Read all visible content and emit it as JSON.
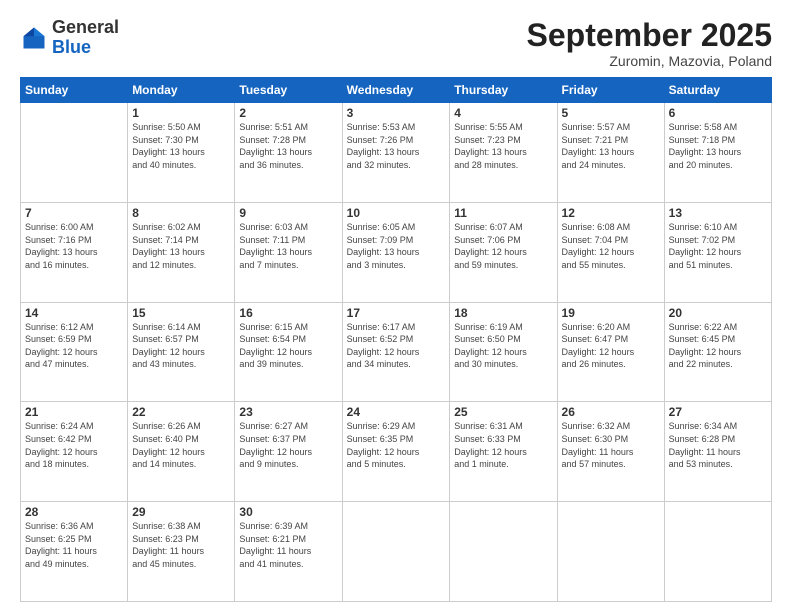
{
  "header": {
    "logo_general": "General",
    "logo_blue": "Blue",
    "month_title": "September 2025",
    "subtitle": "Zuromin, Mazovia, Poland"
  },
  "columns": [
    "Sunday",
    "Monday",
    "Tuesday",
    "Wednesday",
    "Thursday",
    "Friday",
    "Saturday"
  ],
  "weeks": [
    [
      {
        "num": "",
        "info": ""
      },
      {
        "num": "1",
        "info": "Sunrise: 5:50 AM\nSunset: 7:30 PM\nDaylight: 13 hours\nand 40 minutes."
      },
      {
        "num": "2",
        "info": "Sunrise: 5:51 AM\nSunset: 7:28 PM\nDaylight: 13 hours\nand 36 minutes."
      },
      {
        "num": "3",
        "info": "Sunrise: 5:53 AM\nSunset: 7:26 PM\nDaylight: 13 hours\nand 32 minutes."
      },
      {
        "num": "4",
        "info": "Sunrise: 5:55 AM\nSunset: 7:23 PM\nDaylight: 13 hours\nand 28 minutes."
      },
      {
        "num": "5",
        "info": "Sunrise: 5:57 AM\nSunset: 7:21 PM\nDaylight: 13 hours\nand 24 minutes."
      },
      {
        "num": "6",
        "info": "Sunrise: 5:58 AM\nSunset: 7:18 PM\nDaylight: 13 hours\nand 20 minutes."
      }
    ],
    [
      {
        "num": "7",
        "info": "Sunrise: 6:00 AM\nSunset: 7:16 PM\nDaylight: 13 hours\nand 16 minutes."
      },
      {
        "num": "8",
        "info": "Sunrise: 6:02 AM\nSunset: 7:14 PM\nDaylight: 13 hours\nand 12 minutes."
      },
      {
        "num": "9",
        "info": "Sunrise: 6:03 AM\nSunset: 7:11 PM\nDaylight: 13 hours\nand 7 minutes."
      },
      {
        "num": "10",
        "info": "Sunrise: 6:05 AM\nSunset: 7:09 PM\nDaylight: 13 hours\nand 3 minutes."
      },
      {
        "num": "11",
        "info": "Sunrise: 6:07 AM\nSunset: 7:06 PM\nDaylight: 12 hours\nand 59 minutes."
      },
      {
        "num": "12",
        "info": "Sunrise: 6:08 AM\nSunset: 7:04 PM\nDaylight: 12 hours\nand 55 minutes."
      },
      {
        "num": "13",
        "info": "Sunrise: 6:10 AM\nSunset: 7:02 PM\nDaylight: 12 hours\nand 51 minutes."
      }
    ],
    [
      {
        "num": "14",
        "info": "Sunrise: 6:12 AM\nSunset: 6:59 PM\nDaylight: 12 hours\nand 47 minutes."
      },
      {
        "num": "15",
        "info": "Sunrise: 6:14 AM\nSunset: 6:57 PM\nDaylight: 12 hours\nand 43 minutes."
      },
      {
        "num": "16",
        "info": "Sunrise: 6:15 AM\nSunset: 6:54 PM\nDaylight: 12 hours\nand 39 minutes."
      },
      {
        "num": "17",
        "info": "Sunrise: 6:17 AM\nSunset: 6:52 PM\nDaylight: 12 hours\nand 34 minutes."
      },
      {
        "num": "18",
        "info": "Sunrise: 6:19 AM\nSunset: 6:50 PM\nDaylight: 12 hours\nand 30 minutes."
      },
      {
        "num": "19",
        "info": "Sunrise: 6:20 AM\nSunset: 6:47 PM\nDaylight: 12 hours\nand 26 minutes."
      },
      {
        "num": "20",
        "info": "Sunrise: 6:22 AM\nSunset: 6:45 PM\nDaylight: 12 hours\nand 22 minutes."
      }
    ],
    [
      {
        "num": "21",
        "info": "Sunrise: 6:24 AM\nSunset: 6:42 PM\nDaylight: 12 hours\nand 18 minutes."
      },
      {
        "num": "22",
        "info": "Sunrise: 6:26 AM\nSunset: 6:40 PM\nDaylight: 12 hours\nand 14 minutes."
      },
      {
        "num": "23",
        "info": "Sunrise: 6:27 AM\nSunset: 6:37 PM\nDaylight: 12 hours\nand 9 minutes."
      },
      {
        "num": "24",
        "info": "Sunrise: 6:29 AM\nSunset: 6:35 PM\nDaylight: 12 hours\nand 5 minutes."
      },
      {
        "num": "25",
        "info": "Sunrise: 6:31 AM\nSunset: 6:33 PM\nDaylight: 12 hours\nand 1 minute."
      },
      {
        "num": "26",
        "info": "Sunrise: 6:32 AM\nSunset: 6:30 PM\nDaylight: 11 hours\nand 57 minutes."
      },
      {
        "num": "27",
        "info": "Sunrise: 6:34 AM\nSunset: 6:28 PM\nDaylight: 11 hours\nand 53 minutes."
      }
    ],
    [
      {
        "num": "28",
        "info": "Sunrise: 6:36 AM\nSunset: 6:25 PM\nDaylight: 11 hours\nand 49 minutes."
      },
      {
        "num": "29",
        "info": "Sunrise: 6:38 AM\nSunset: 6:23 PM\nDaylight: 11 hours\nand 45 minutes."
      },
      {
        "num": "30",
        "info": "Sunrise: 6:39 AM\nSunset: 6:21 PM\nDaylight: 11 hours\nand 41 minutes."
      },
      {
        "num": "",
        "info": ""
      },
      {
        "num": "",
        "info": ""
      },
      {
        "num": "",
        "info": ""
      },
      {
        "num": "",
        "info": ""
      }
    ]
  ]
}
